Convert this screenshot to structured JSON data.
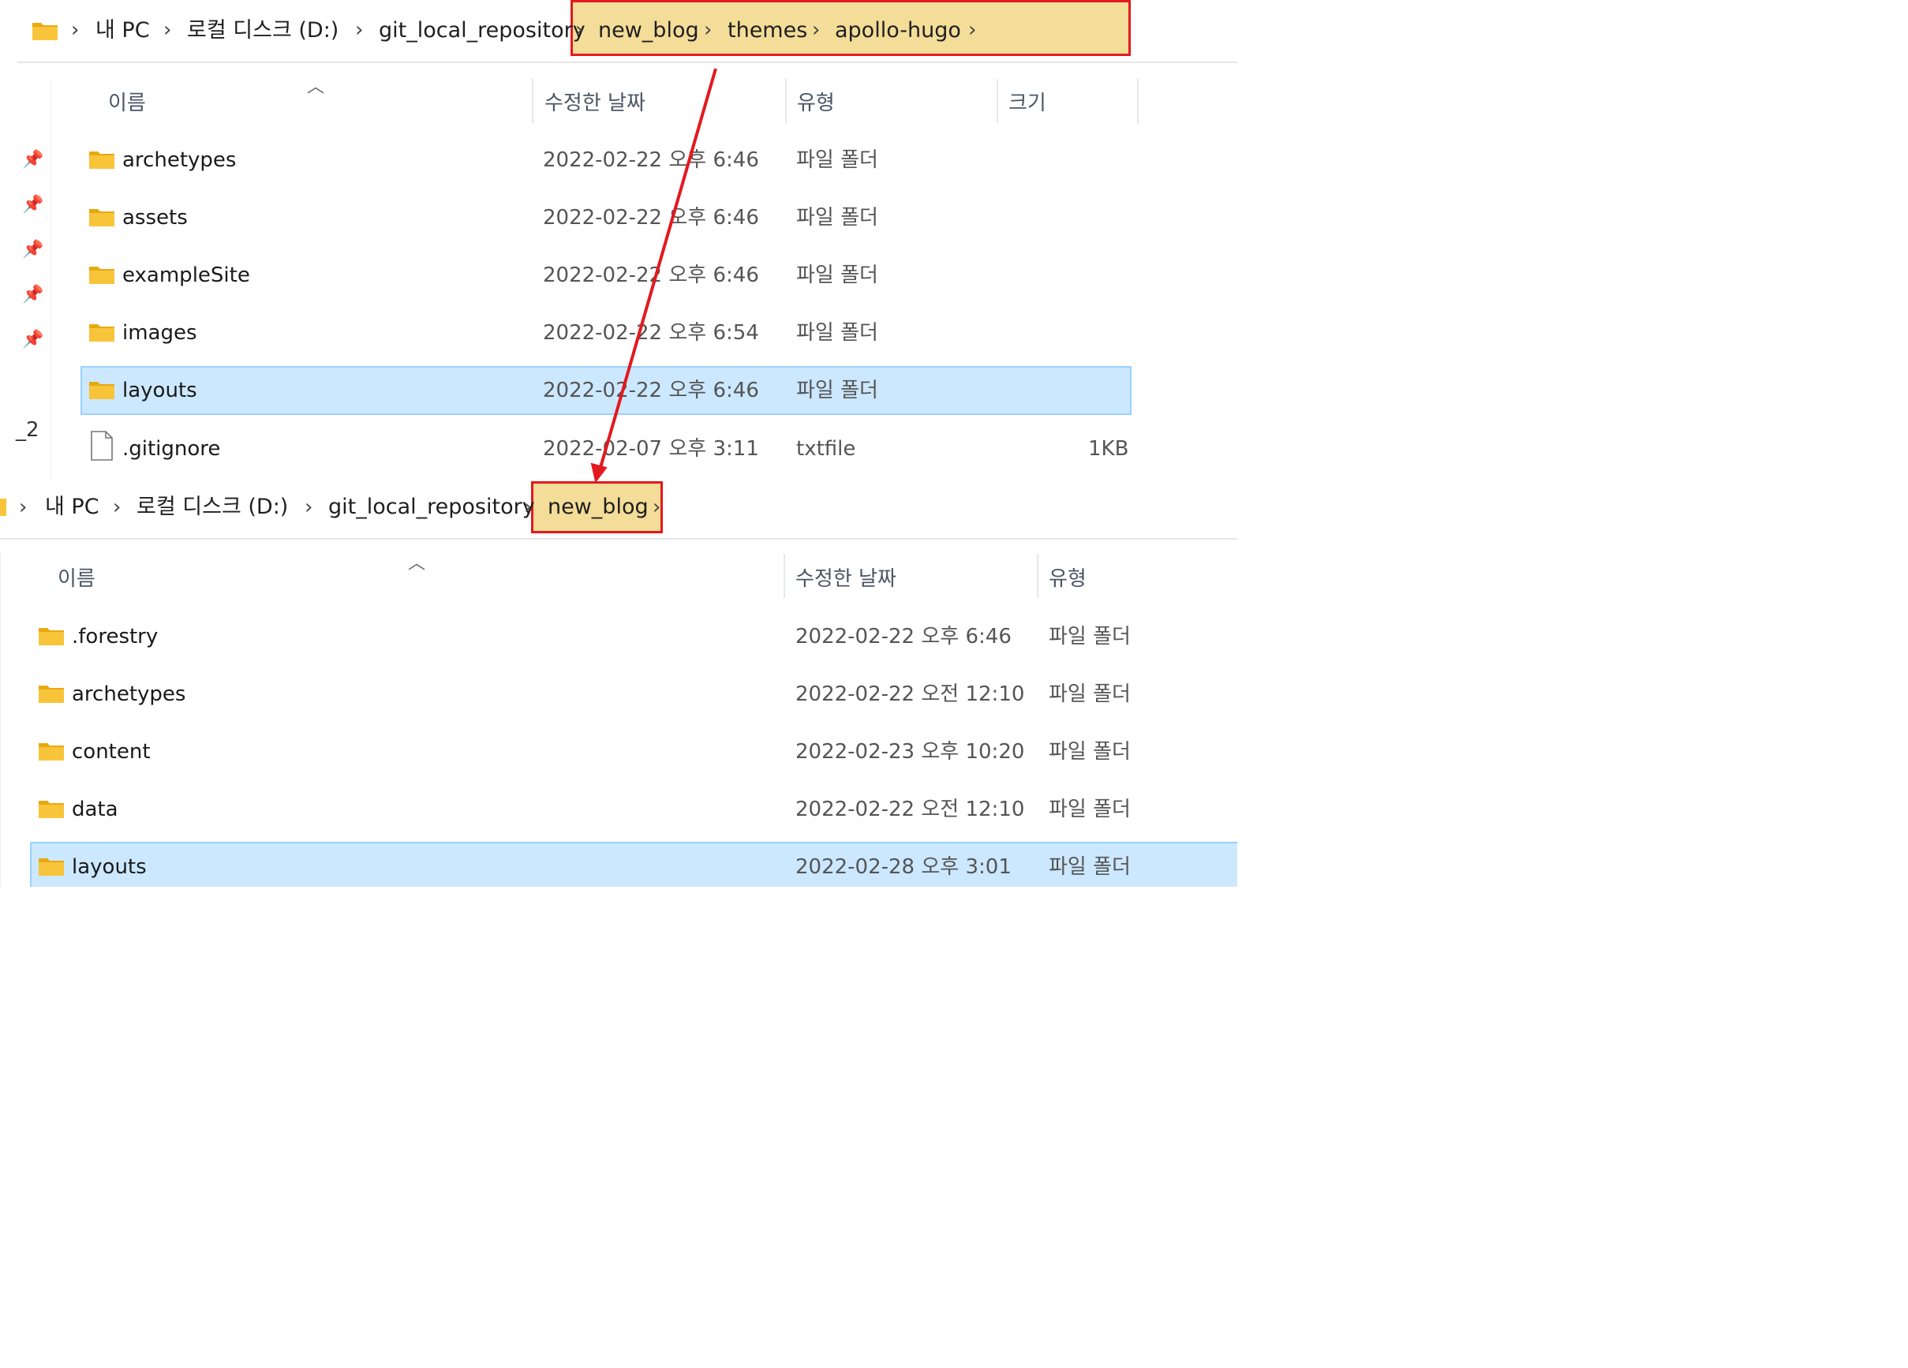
{
  "top_window": {
    "breadcrumb": [
      "내 PC",
      "로컬 디스크 (D:)",
      "git_local_repository",
      "new_blog",
      "themes",
      "apollo-hugo"
    ],
    "columns": {
      "name": "이름",
      "modified": "수정한 날짜",
      "type": "유형",
      "size": "크기"
    },
    "sidebar_text": "_2",
    "rows": [
      {
        "name": "archetypes",
        "modified": "2022-02-22 오후 6:46",
        "type": "파일 폴더",
        "size": "",
        "icon": "folder-icon"
      },
      {
        "name": "assets",
        "modified": "2022-02-22 오후 6:46",
        "type": "파일 폴더",
        "size": "",
        "icon": "folder-icon"
      },
      {
        "name": "exampleSite",
        "modified": "2022-02-22 오후 6:46",
        "type": "파일 폴더",
        "size": "",
        "icon": "folder-icon"
      },
      {
        "name": "images",
        "modified": "2022-02-22 오후 6:54",
        "type": "파일 폴더",
        "size": "",
        "icon": "folder-icon"
      },
      {
        "name": "layouts",
        "modified": "2022-02-22 오후 6:46",
        "type": "파일 폴더",
        "size": "",
        "icon": "folder-icon",
        "selected": true
      },
      {
        "name": ".gitignore",
        "modified": "2022-02-07 오후 3:11",
        "type": "txtfile",
        "size": "1KB",
        "icon": "file-icon"
      }
    ]
  },
  "bottom_window": {
    "breadcrumb": [
      "내 PC",
      "로컬 디스크 (D:)",
      "git_local_repository",
      "new_blog"
    ],
    "columns": {
      "name": "이름",
      "modified": "수정한 날짜",
      "type": "유형"
    },
    "rows": [
      {
        "name": ".forestry",
        "modified": "2022-02-22 오후 6:46",
        "type": "파일 폴더",
        "icon": "folder-icon"
      },
      {
        "name": "archetypes",
        "modified": "2022-02-22 오전 12:10",
        "type": "파일 폴더",
        "icon": "folder-icon"
      },
      {
        "name": "content",
        "modified": "2022-02-23 오후 10:20",
        "type": "파일 폴더",
        "icon": "folder-icon"
      },
      {
        "name": "data",
        "modified": "2022-02-22 오전 12:10",
        "type": "파일 폴더",
        "icon": "folder-icon"
      },
      {
        "name": "layouts",
        "modified": "2022-02-28 오후 3:01",
        "type": "파일 폴더",
        "icon": "folder-icon",
        "selected": true
      }
    ]
  },
  "annotation": {
    "arrow_color": "#e3191f",
    "highlight_fill": "#f3dd98",
    "highlight_border": "#e3191f"
  },
  "colors": {
    "folder": "#f8c43a",
    "folder_dark": "#e8a90f",
    "selection": "#cce8ff"
  }
}
